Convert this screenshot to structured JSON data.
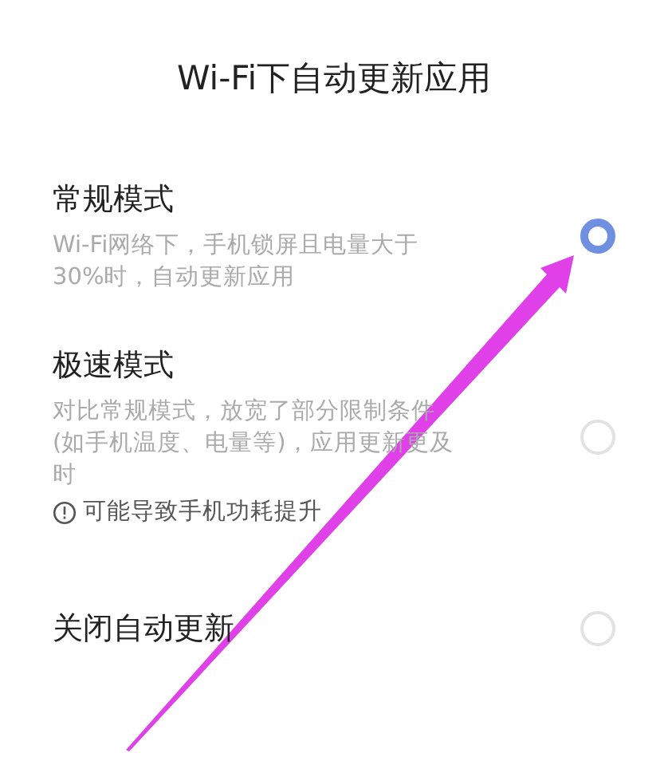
{
  "title": "Wi-Fi下自动更新应用",
  "options": [
    {
      "label": "常规模式",
      "description": "Wi-Fi网络下，手机锁屏且电量大于30%时，自动更新应用",
      "selected": true
    },
    {
      "label": "极速模式",
      "description": "对比常规模式，放宽了部分限制条件(如手机温度、电量等)，应用更新更及时",
      "warning": "可能导致手机功耗提升",
      "selected": false
    },
    {
      "label": "关闭自动更新",
      "selected": false
    }
  ]
}
